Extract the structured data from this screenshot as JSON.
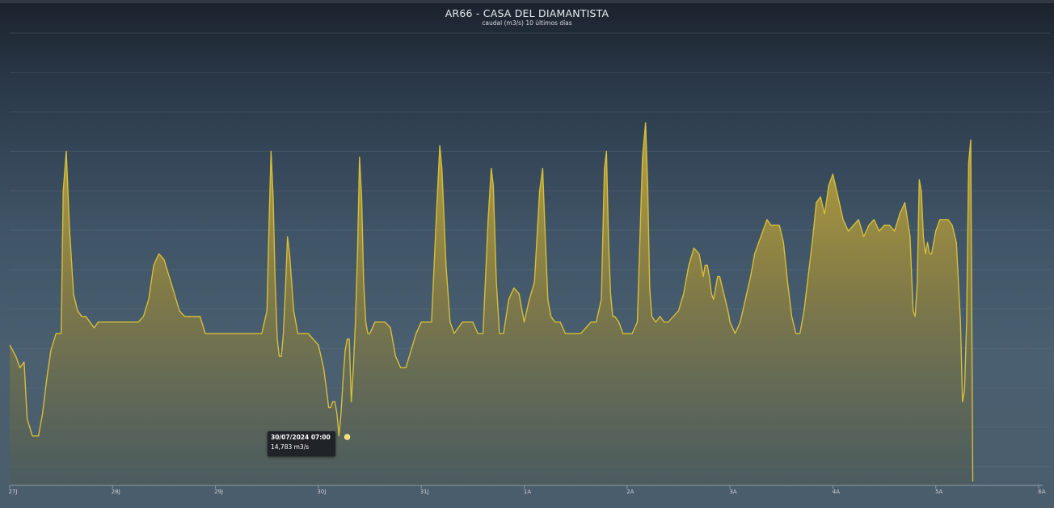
{
  "chart_data": {
    "type": "area",
    "title": "AR66 - CASA DEL DIAMANTISTA",
    "subtitle": "caudal (m3/s) 10 últimos días",
    "xlabel": "",
    "ylabel": "",
    "x_tick_labels": [
      "27J",
      "28J",
      "29J",
      "30J",
      "31J",
      "1A",
      "2A",
      "3A",
      "4A",
      "5A",
      "6A"
    ],
    "x_range_days": [
      0,
      10
    ],
    "grid": true,
    "series": [
      {
        "color": "#d6be3a",
        "points": [
          [
            0.0,
            16.4
          ],
          [
            0.06,
            16.2
          ],
          [
            0.1,
            16.0
          ],
          [
            0.14,
            16.1
          ],
          [
            0.17,
            15.1
          ],
          [
            0.22,
            14.8
          ],
          [
            0.28,
            14.8
          ],
          [
            0.32,
            15.2
          ],
          [
            0.36,
            15.8
          ],
          [
            0.4,
            16.3
          ],
          [
            0.45,
            16.6
          ],
          [
            0.5,
            16.6
          ],
          [
            0.52,
            19.1
          ],
          [
            0.55,
            19.8
          ],
          [
            0.58,
            18.5
          ],
          [
            0.62,
            17.3
          ],
          [
            0.66,
            17.0
          ],
          [
            0.7,
            16.9
          ],
          [
            0.74,
            16.9
          ],
          [
            0.78,
            16.8
          ],
          [
            0.82,
            16.7
          ],
          [
            0.86,
            16.8
          ],
          [
            0.9,
            16.8
          ],
          [
            0.95,
            16.8
          ],
          [
            1.0,
            16.8
          ],
          [
            1.05,
            16.8
          ],
          [
            1.1,
            16.8
          ],
          [
            1.15,
            16.8
          ],
          [
            1.2,
            16.8
          ],
          [
            1.25,
            16.8
          ],
          [
            1.3,
            16.9
          ],
          [
            1.35,
            17.2
          ],
          [
            1.4,
            17.8
          ],
          [
            1.45,
            18.0
          ],
          [
            1.5,
            17.9
          ],
          [
            1.55,
            17.6
          ],
          [
            1.6,
            17.3
          ],
          [
            1.65,
            17.0
          ],
          [
            1.7,
            16.9
          ],
          [
            1.75,
            16.9
          ],
          [
            1.8,
            16.9
          ],
          [
            1.85,
            16.9
          ],
          [
            1.9,
            16.6
          ],
          [
            2.0,
            16.6
          ],
          [
            2.1,
            16.6
          ],
          [
            2.2,
            16.6
          ],
          [
            2.3,
            16.6
          ],
          [
            2.4,
            16.6
          ],
          [
            2.45,
            16.6
          ],
          [
            2.5,
            17.0
          ],
          [
            2.52,
            18.5
          ],
          [
            2.54,
            19.8
          ],
          [
            2.56,
            19.0
          ],
          [
            2.58,
            17.5
          ],
          [
            2.6,
            16.5
          ],
          [
            2.62,
            16.2
          ],
          [
            2.64,
            16.2
          ],
          [
            2.66,
            16.6
          ],
          [
            2.68,
            17.4
          ],
          [
            2.7,
            18.3
          ],
          [
            2.72,
            18.0
          ],
          [
            2.74,
            17.5
          ],
          [
            2.76,
            17.0
          ],
          [
            2.78,
            16.8
          ],
          [
            2.8,
            16.6
          ],
          [
            2.85,
            16.6
          ],
          [
            2.9,
            16.6
          ],
          [
            2.95,
            16.5
          ],
          [
            3.0,
            16.4
          ],
          [
            3.05,
            16.0
          ],
          [
            3.08,
            15.6
          ],
          [
            3.1,
            15.3
          ],
          [
            3.12,
            15.3
          ],
          [
            3.14,
            15.4
          ],
          [
            3.16,
            15.4
          ],
          [
            3.18,
            15.2
          ],
          [
            3.2,
            14.8
          ],
          [
            3.22,
            15.2
          ],
          [
            3.24,
            15.8
          ],
          [
            3.26,
            16.3
          ],
          [
            3.28,
            16.5
          ],
          [
            3.3,
            16.5
          ],
          [
            3.32,
            15.4
          ],
          [
            3.34,
            16.0
          ],
          [
            3.36,
            16.8
          ],
          [
            3.38,
            18.0
          ],
          [
            3.4,
            19.7
          ],
          [
            3.42,
            19.0
          ],
          [
            3.44,
            17.5
          ],
          [
            3.46,
            16.8
          ],
          [
            3.48,
            16.6
          ],
          [
            3.5,
            16.6
          ],
          [
            3.55,
            16.8
          ],
          [
            3.6,
            16.8
          ],
          [
            3.65,
            16.8
          ],
          [
            3.7,
            16.7
          ],
          [
            3.75,
            16.2
          ],
          [
            3.8,
            16.0
          ],
          [
            3.85,
            16.0
          ],
          [
            3.9,
            16.3
          ],
          [
            3.95,
            16.6
          ],
          [
            4.0,
            16.8
          ],
          [
            4.05,
            16.8
          ],
          [
            4.1,
            16.8
          ],
          [
            4.15,
            18.8
          ],
          [
            4.18,
            19.9
          ],
          [
            4.2,
            19.5
          ],
          [
            4.24,
            17.8
          ],
          [
            4.28,
            16.8
          ],
          [
            4.32,
            16.6
          ],
          [
            4.36,
            16.7
          ],
          [
            4.4,
            16.8
          ],
          [
            4.45,
            16.8
          ],
          [
            4.5,
            16.8
          ],
          [
            4.55,
            16.6
          ],
          [
            4.6,
            16.6
          ],
          [
            4.65,
            18.6
          ],
          [
            4.68,
            19.5
          ],
          [
            4.7,
            19.2
          ],
          [
            4.73,
            17.5
          ],
          [
            4.76,
            16.6
          ],
          [
            4.8,
            16.6
          ],
          [
            4.85,
            17.2
          ],
          [
            4.9,
            17.4
          ],
          [
            4.95,
            17.3
          ],
          [
            5.0,
            16.8
          ],
          [
            5.05,
            17.2
          ],
          [
            5.1,
            17.5
          ],
          [
            5.15,
            19.1
          ],
          [
            5.18,
            19.5
          ],
          [
            5.2,
            18.5
          ],
          [
            5.23,
            17.2
          ],
          [
            5.26,
            16.9
          ],
          [
            5.3,
            16.8
          ],
          [
            5.35,
            16.8
          ],
          [
            5.4,
            16.6
          ],
          [
            5.45,
            16.6
          ],
          [
            5.5,
            16.6
          ],
          [
            5.55,
            16.6
          ],
          [
            5.6,
            16.7
          ],
          [
            5.65,
            16.8
          ],
          [
            5.7,
            16.8
          ],
          [
            5.75,
            17.2
          ],
          [
            5.78,
            19.5
          ],
          [
            5.8,
            19.8
          ],
          [
            5.82,
            18.2
          ],
          [
            5.84,
            17.3
          ],
          [
            5.86,
            16.9
          ],
          [
            5.88,
            16.9
          ],
          [
            5.92,
            16.8
          ],
          [
            5.96,
            16.6
          ],
          [
            6.0,
            16.6
          ],
          [
            6.05,
            16.6
          ],
          [
            6.1,
            16.8
          ],
          [
            6.15,
            19.7
          ],
          [
            6.18,
            20.3
          ],
          [
            6.2,
            19.2
          ],
          [
            6.22,
            17.4
          ],
          [
            6.24,
            16.9
          ],
          [
            6.28,
            16.8
          ],
          [
            6.32,
            16.9
          ],
          [
            6.36,
            16.8
          ],
          [
            6.4,
            16.8
          ],
          [
            6.45,
            16.9
          ],
          [
            6.5,
            17.0
          ],
          [
            6.55,
            17.3
          ],
          [
            6.6,
            17.8
          ],
          [
            6.65,
            18.1
          ],
          [
            6.7,
            18.0
          ],
          [
            6.72,
            17.8
          ],
          [
            6.74,
            17.6
          ],
          [
            6.76,
            17.8
          ],
          [
            6.78,
            17.8
          ],
          [
            6.8,
            17.6
          ],
          [
            6.82,
            17.3
          ],
          [
            6.84,
            17.2
          ],
          [
            6.86,
            17.4
          ],
          [
            6.88,
            17.6
          ],
          [
            6.9,
            17.6
          ],
          [
            6.94,
            17.3
          ],
          [
            6.98,
            17.0
          ],
          [
            7.0,
            16.8
          ],
          [
            7.05,
            16.6
          ],
          [
            7.1,
            16.8
          ],
          [
            7.15,
            17.2
          ],
          [
            7.2,
            17.6
          ],
          [
            7.24,
            18.0
          ],
          [
            7.28,
            18.2
          ],
          [
            7.32,
            18.4
          ],
          [
            7.36,
            18.6
          ],
          [
            7.4,
            18.5
          ],
          [
            7.44,
            18.5
          ],
          [
            7.48,
            18.5
          ],
          [
            7.52,
            18.2
          ],
          [
            7.56,
            17.5
          ],
          [
            7.6,
            16.9
          ],
          [
            7.64,
            16.6
          ],
          [
            7.68,
            16.6
          ],
          [
            7.72,
            17.0
          ],
          [
            7.76,
            17.6
          ],
          [
            7.8,
            18.2
          ],
          [
            7.84,
            18.9
          ],
          [
            7.88,
            19.0
          ],
          [
            7.92,
            18.7
          ],
          [
            7.96,
            19.2
          ],
          [
            8.0,
            19.4
          ],
          [
            8.05,
            19.0
          ],
          [
            8.1,
            18.6
          ],
          [
            8.15,
            18.4
          ],
          [
            8.2,
            18.5
          ],
          [
            8.25,
            18.6
          ],
          [
            8.3,
            18.3
          ],
          [
            8.35,
            18.5
          ],
          [
            8.4,
            18.6
          ],
          [
            8.45,
            18.4
          ],
          [
            8.5,
            18.5
          ],
          [
            8.55,
            18.5
          ],
          [
            8.6,
            18.4
          ],
          [
            8.65,
            18.7
          ],
          [
            8.7,
            18.9
          ],
          [
            8.75,
            18.3
          ],
          [
            8.78,
            17.0
          ],
          [
            8.8,
            16.9
          ],
          [
            8.82,
            17.5
          ],
          [
            8.84,
            19.3
          ],
          [
            8.86,
            19.1
          ],
          [
            8.88,
            18.3
          ],
          [
            8.9,
            18.0
          ],
          [
            8.92,
            18.2
          ],
          [
            8.94,
            18.0
          ],
          [
            8.96,
            18.0
          ],
          [
            9.0,
            18.4
          ],
          [
            9.04,
            18.6
          ],
          [
            9.08,
            18.6
          ],
          [
            9.12,
            18.6
          ],
          [
            9.16,
            18.5
          ],
          [
            9.2,
            18.2
          ],
          [
            9.24,
            16.8
          ],
          [
            9.26,
            15.4
          ],
          [
            9.28,
            15.6
          ],
          [
            9.3,
            16.8
          ],
          [
            9.32,
            19.6
          ],
          [
            9.34,
            20.0
          ],
          [
            9.36,
            14.0
          ]
        ]
      }
    ],
    "tooltip": {
      "date": "30/07/2024 07:00",
      "value": "14,783 m3/s",
      "x": 3.28,
      "y": 14.783
    }
  }
}
